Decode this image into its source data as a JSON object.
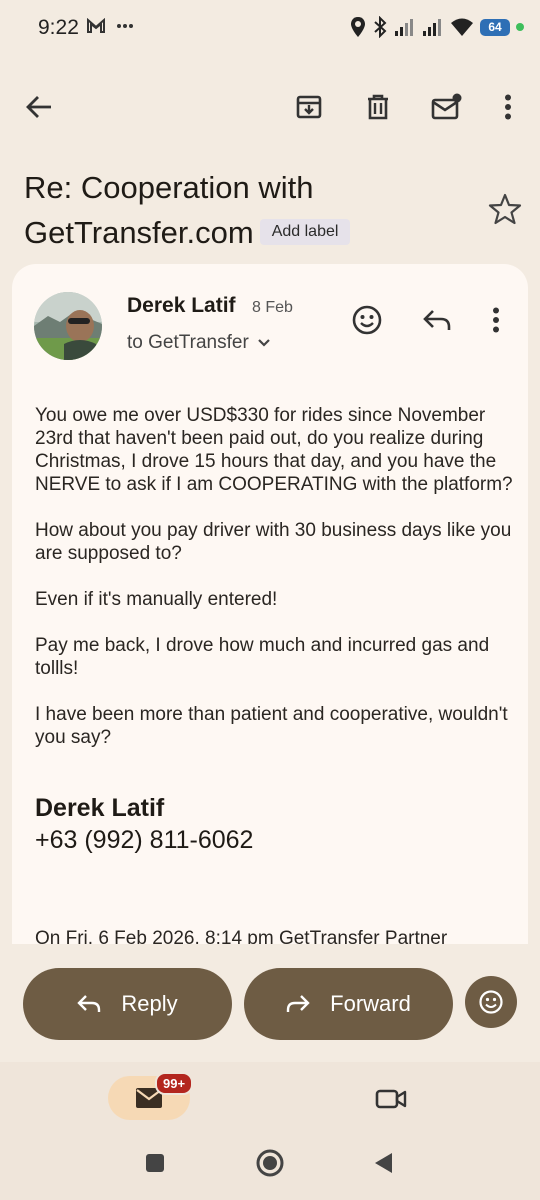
{
  "status_bar": {
    "time": "9:22",
    "battery": "64",
    "icons": [
      "gmail-icon",
      "more-dots-icon",
      "location-icon",
      "bluetooth-icon",
      "signal-icon",
      "signal-icon",
      "wifi-icon",
      "battery-icon",
      "privacy-dot-icon"
    ]
  },
  "toolbar": {
    "icons": [
      "back-arrow-icon",
      "archive-icon",
      "delete-icon",
      "mark-unread-icon",
      "more-vert-icon"
    ]
  },
  "email": {
    "subject": "Re: Cooperation with GetTransfer.com",
    "label_chip": "Add label",
    "sender": "Derek Latif",
    "date": "8 Feb",
    "recipient": "to GetTransfer",
    "body": [
      "You owe me over USD$330 for rides since November 23rd that haven't been paid out, do you realize during Christmas, I drove 15 hours that day, and you have the NERVE to ask if I am COOPERATING with the platform?",
      "How about you pay driver with 30 business days like you are supposed to?",
      "Even if it's manually entered!",
      "Pay me back, I drove how much and incurred gas and tollls!",
      "I have been more than patient and cooperative, wouldn't you say?"
    ],
    "signature_name": "Derek Latif",
    "signature_phone": "+63 (992) 811-6062",
    "quoted_line": "On Fri, 6 Feb 2026, 8:14 pm GetTransfer Partner"
  },
  "actions": {
    "reply": "Reply",
    "forward": "Forward"
  },
  "bottom_nav": {
    "mail_badge": "99+"
  },
  "colors": {
    "background": "#F3EBE1",
    "card": "#FEF8F3",
    "button": "#6E5C44",
    "badge": "#B3261E",
    "mail_pill": "#F6D9B5"
  }
}
